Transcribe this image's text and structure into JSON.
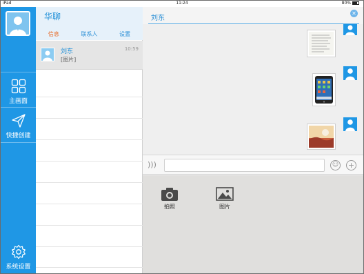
{
  "status_bar": {
    "device": "iPad",
    "time": "11:24",
    "battery": "80%"
  },
  "nav": {
    "items": [
      {
        "label": "主画面",
        "icon": "grid-icon"
      },
      {
        "label": "快捷创建",
        "icon": "send-icon"
      },
      {
        "label": "系统设置",
        "icon": "gear-icon"
      }
    ],
    "accent": "#1f97e5"
  },
  "list_panel": {
    "title": "华聊",
    "tabs": [
      "信息",
      "联系人",
      "设置"
    ],
    "active_tab": "信息",
    "conversations": [
      {
        "name": "刘东",
        "last_message": "[图片]",
        "time": "10:59"
      }
    ]
  },
  "chat": {
    "title": "刘东",
    "close_icon": "close-icon",
    "messages": [
      {
        "type": "image",
        "content": "document-photo"
      },
      {
        "type": "image",
        "content": "tablet-photo"
      },
      {
        "type": "image",
        "content": "landscape-photo"
      }
    ],
    "input": {
      "value": "",
      "placeholder": ""
    },
    "tray": [
      {
        "label": "拍照",
        "icon": "camera-icon"
      },
      {
        "label": "图片",
        "icon": "image-icon"
      }
    ]
  }
}
